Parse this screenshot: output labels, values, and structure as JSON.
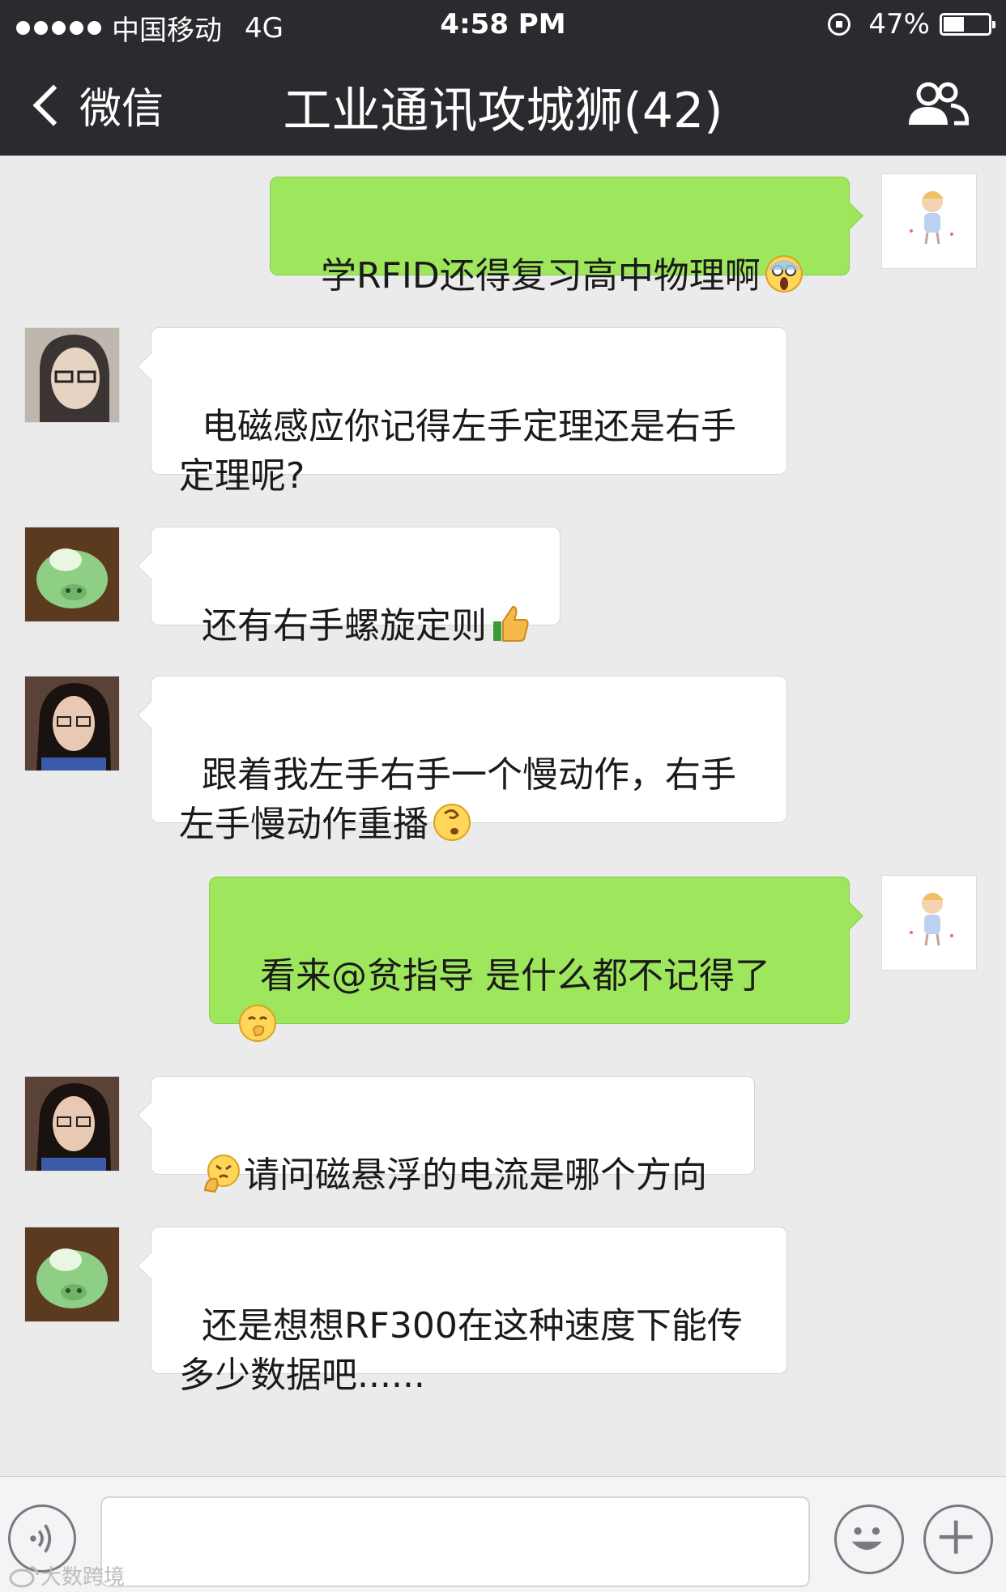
{
  "status_bar": {
    "carrier": "中国移动",
    "network": "4G",
    "time": "4:58 PM",
    "battery_percent_label": "47%",
    "battery_level": 0.47,
    "signal_icon": "signal-dots-icon",
    "lock_icon": "orientation-lock-icon"
  },
  "nav": {
    "back_label": "微信",
    "title": "工业通讯攻城狮(42)",
    "group_icon": "group-members-icon"
  },
  "messages": [
    {
      "direction": "out",
      "text": "学RFID还得复习高中物理啊",
      "emoji": "scream-emoji"
    },
    {
      "direction": "in",
      "text": "电磁感应你记得左手定理还是右手\n定理呢?",
      "emoji": ""
    },
    {
      "direction": "in",
      "text": "还有右手螺旋定则",
      "emoji": "thumbs-up-emoji"
    },
    {
      "direction": "in",
      "text": "跟着我左手右手一个慢动作，右手\n左手慢动作重播",
      "emoji": "dizzy-face-emoji"
    },
    {
      "direction": "out",
      "text": "看来@贫指导 是什么都不记得了\n",
      "emoji": "shush-emoji"
    },
    {
      "direction": "in",
      "text": "请问磁悬浮的电流是哪个方向",
      "emoji": "angry-fist-emoji",
      "emoji_first": true
    },
    {
      "direction": "in",
      "text": "还是想想RF300在这种速度下能传\n多少数据吧......",
      "emoji": ""
    }
  ],
  "input_bar": {
    "voice_icon": "voice-icon",
    "emoji_icon": "smiley-icon",
    "plus_icon": "plus-icon"
  },
  "watermark": {
    "text": "大数跨境",
    "logo": "weibo-logo-icon"
  },
  "colors": {
    "nav_bg": "#2b2b2f",
    "chat_bg": "#ebebeb",
    "outgoing_bubble": "#9ee65b",
    "incoming_bubble": "#ffffff"
  }
}
